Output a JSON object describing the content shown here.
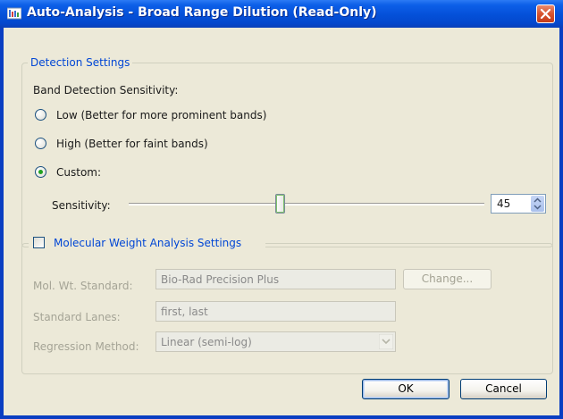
{
  "window": {
    "title": "Auto-Analysis - Broad Range Dilution (Read-Only)",
    "title_icon": "bar-chart-icon",
    "close_icon": "close-icon"
  },
  "detection": {
    "legend": "Detection Settings",
    "sensitivity_heading": "Band Detection Sensitivity:",
    "options": [
      {
        "label": "Low (Better for more prominent bands)",
        "selected": false
      },
      {
        "label": "High (Better for faint bands)",
        "selected": false
      },
      {
        "label": "Custom:",
        "selected": true
      }
    ],
    "sensitivity_label": "Sensitivity:",
    "sensitivity_value": "45"
  },
  "mw": {
    "checkbox_label": "Molecular Weight Analysis Settings",
    "checked": false,
    "standard_label": "Mol. Wt. Standard:",
    "standard_value": "Bio-Rad Precision Plus",
    "change_button": "Change...",
    "lanes_label": "Standard Lanes:",
    "lanes_value": "first, last",
    "regression_label": "Regression Method:",
    "regression_value": "Linear (semi-log)"
  },
  "buttons": {
    "ok": "OK",
    "cancel": "Cancel"
  },
  "colors": {
    "titlebar": "#0450d8",
    "group_legend": "#0046d5",
    "dialog_bg": "#ece9d8",
    "close_button": "#d7542f"
  }
}
